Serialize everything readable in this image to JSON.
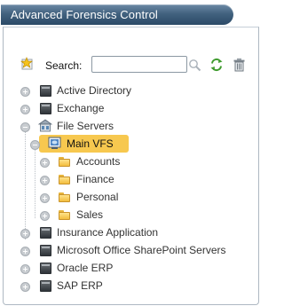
{
  "window": {
    "title": "Advanced Forensics Control"
  },
  "toolbar": {
    "search_label": "Search:",
    "search_value": "",
    "search_placeholder": ""
  },
  "tree": {
    "nodes": [
      {
        "label": "Active Directory",
        "expanded": false
      },
      {
        "label": "Exchange",
        "expanded": false
      },
      {
        "label": "File Servers",
        "expanded": true
      },
      {
        "label": "Main VFS",
        "expanded": true,
        "selected": true
      },
      {
        "label": "Accounts",
        "expanded": false
      },
      {
        "label": "Finance",
        "expanded": false
      },
      {
        "label": "Personal",
        "expanded": false
      },
      {
        "label": "Sales",
        "expanded": false
      },
      {
        "label": "Insurance Application",
        "expanded": false
      },
      {
        "label": "Microsoft Office SharePoint Servers",
        "expanded": false
      },
      {
        "label": "Oracle ERP",
        "expanded": false
      },
      {
        "label": "SAP ERP",
        "expanded": false
      }
    ]
  }
}
